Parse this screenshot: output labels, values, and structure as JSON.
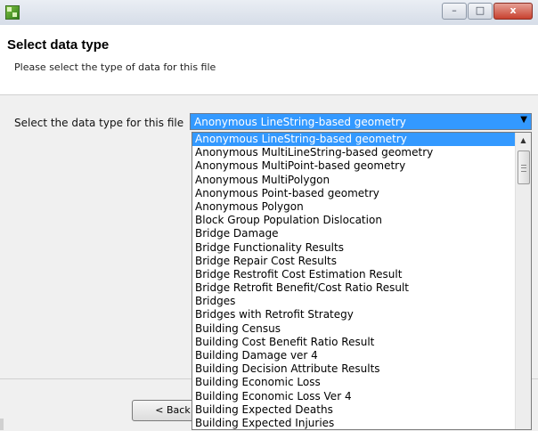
{
  "window": {
    "title": "",
    "buttons": {
      "minimize": "–",
      "maximize": "□",
      "close": "x"
    }
  },
  "header": {
    "title": "Select data type",
    "subtitle": "Please select the type of data for this file"
  },
  "form": {
    "label": "Select the data type for this file",
    "selected": "Anonymous LineString-based geometry"
  },
  "dropdown": {
    "options": [
      "Anonymous LineString-based geometry",
      "Anonymous MultiLineString-based geometry",
      "Anonymous MultiPoint-based geometry",
      "Anonymous MultiPolygon",
      "Anonymous Point-based geometry",
      "Anonymous Polygon",
      "Block Group Population Dislocation",
      "Bridge Damage",
      "Bridge Functionality Results",
      "Bridge Repair Cost Results",
      "Bridge Restrofit Cost Estimation Result",
      "Bridge Retrofit Benefit/Cost Ratio Result",
      "Bridges",
      "Bridges with Retrofit Strategy",
      "Building Census",
      "Building Cost Benefit Ratio Result",
      "Building Damage ver 4",
      "Building Decision Attribute Results",
      "Building Economic Loss",
      "Building Economic Loss Ver 4",
      "Building Expected Deaths",
      "Building Expected Injuries"
    ],
    "selected_index": 0
  },
  "footer": {
    "back_label": "< Back"
  }
}
